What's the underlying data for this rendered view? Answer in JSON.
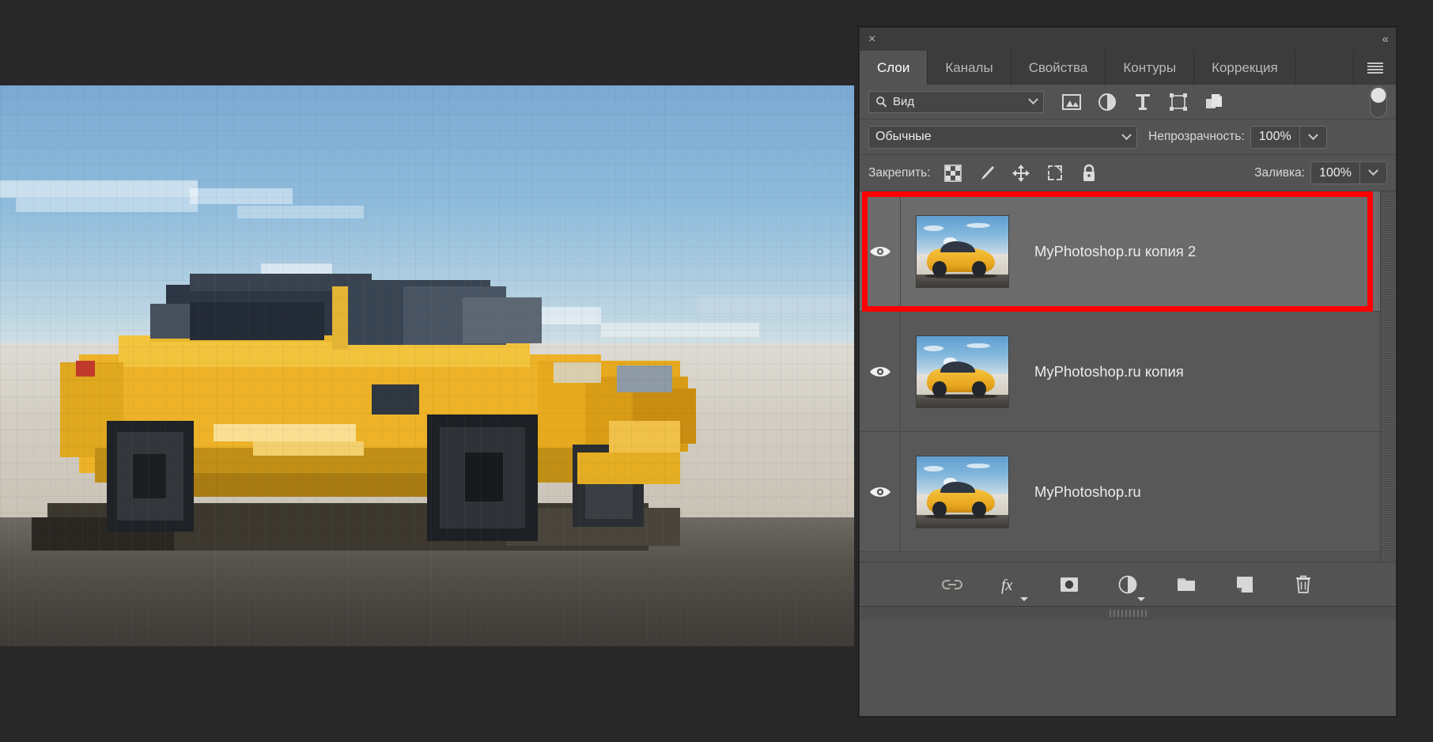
{
  "panel": {
    "titlebar": {
      "close_label": "×",
      "collapse_label": "«"
    },
    "tabs": [
      {
        "label": "Слои",
        "active": true
      },
      {
        "label": "Каналы",
        "active": false
      },
      {
        "label": "Свойства",
        "active": false
      },
      {
        "label": "Контуры",
        "active": false
      },
      {
        "label": "Коррекция",
        "active": false
      }
    ],
    "menu_icon": "hamburger-menu-icon"
  },
  "filter_row": {
    "search_icon": "search-icon",
    "filter_type_value": "Вид",
    "dropdown_icon": "chevron-down-icon",
    "type_filters": [
      {
        "name": "filter-pixel-layers-icon",
        "title": "Пиксельные"
      },
      {
        "name": "filter-adjustment-layers-icon",
        "title": "Корректирующие"
      },
      {
        "name": "filter-type-layers-icon",
        "title": "Текстовые"
      },
      {
        "name": "filter-shape-layers-icon",
        "title": "Фигуры"
      },
      {
        "name": "filter-smart-object-layers-icon",
        "title": "Смарт-объекты"
      }
    ],
    "toggle_name": "filter-enable-toggle"
  },
  "blend_row": {
    "mode_value": "Обычные",
    "opacity_label": "Непрозрачность:",
    "opacity_value": "100%"
  },
  "lock_row": {
    "lock_label": "Закрепить:",
    "locks": [
      {
        "name": "lock-transparent-pixels-icon"
      },
      {
        "name": "lock-image-pixels-icon"
      },
      {
        "name": "lock-position-icon"
      },
      {
        "name": "lock-artboard-nesting-icon"
      },
      {
        "name": "lock-all-icon"
      }
    ],
    "fill_label": "Заливка:",
    "fill_value": "100%"
  },
  "layers": [
    {
      "name": "MyPhotoshop.ru копия 2",
      "visible": true,
      "selected": true
    },
    {
      "name": "MyPhotoshop.ru копия",
      "visible": true,
      "selected": false
    },
    {
      "name": "MyPhotoshop.ru",
      "visible": true,
      "selected": false
    }
  ],
  "bottom_bar": {
    "buttons": [
      {
        "name": "link-layers-button",
        "icon": "link-icon"
      },
      {
        "name": "layer-style-button",
        "icon": "fx-icon"
      },
      {
        "name": "add-layer-mask-button",
        "icon": "mask-icon"
      },
      {
        "name": "new-adjustment-layer-button",
        "icon": "adjustment-icon"
      },
      {
        "name": "new-group-button",
        "icon": "folder-icon"
      },
      {
        "name": "new-layer-button",
        "icon": "new-layer-icon"
      },
      {
        "name": "delete-layer-button",
        "icon": "trash-icon"
      }
    ]
  },
  "annotation": {
    "highlight_color": "#ff0000"
  },
  "colors": {
    "panel_bg": "#535353",
    "tabbar_bg": "#3c3c3c",
    "row_bg": "#585858",
    "row_selected_bg": "#6b6b6b",
    "app_bg": "#282828",
    "text": "#ececec"
  },
  "canvas": {
    "title": "pixelated-yellow-sports-car"
  }
}
